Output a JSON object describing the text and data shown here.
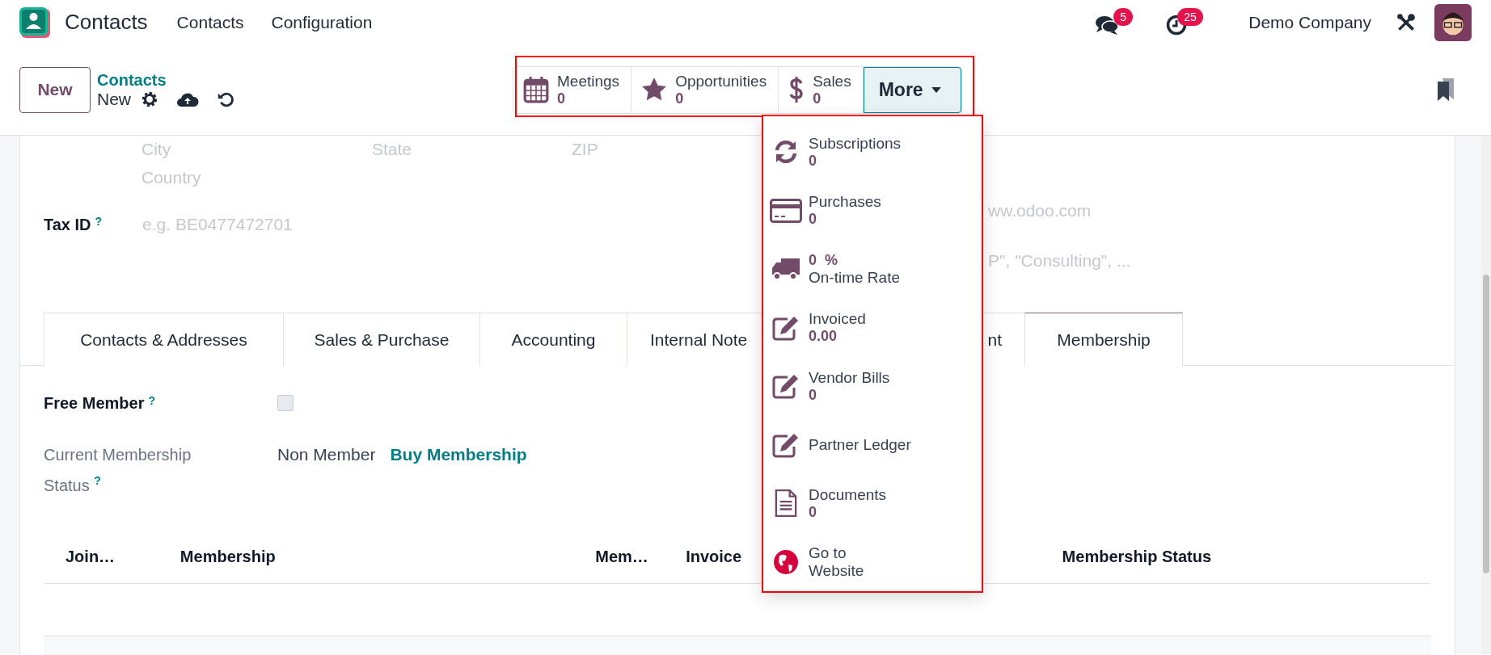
{
  "navbar": {
    "app_name": "Contacts",
    "menu": [
      "Contacts",
      "Configuration"
    ],
    "messages_badge": "5",
    "activities_badge": "25",
    "company": "Demo Company"
  },
  "control_panel": {
    "new_button": "New",
    "breadcrumb": "Contacts",
    "record": "New"
  },
  "smart_buttons": [
    {
      "label": "Meetings",
      "value": "0"
    },
    {
      "label": "Opportunities",
      "value": "0"
    },
    {
      "label": "Sales",
      "value": "0"
    }
  ],
  "more_button": {
    "label": "More",
    "expanded": true
  },
  "more_menu": [
    {
      "kind": "stat",
      "label": "Subscriptions",
      "value": "0"
    },
    {
      "kind": "stat",
      "label": "Purchases",
      "value": "0"
    },
    {
      "kind": "value_first",
      "label": "On-time Rate",
      "value": "0  %"
    },
    {
      "kind": "stat",
      "label": "Invoiced",
      "value": "0.00"
    },
    {
      "kind": "stat",
      "label": "Vendor Bills",
      "value": "0"
    },
    {
      "kind": "label",
      "label": "Partner Ledger"
    },
    {
      "kind": "stat",
      "label": "Documents",
      "value": "0"
    },
    {
      "kind": "label_wrap",
      "label": "Go to Website"
    }
  ],
  "form": {
    "address_placeholders": [
      "City",
      "State",
      "ZIP"
    ],
    "country_placeholder": "Country",
    "tax_id": {
      "label": "Tax ID",
      "help": "?",
      "placeholder": "e.g. BE0477472701"
    },
    "right_field_placeholders": [
      "ww.odoo.com",
      "P\", \"Consulting\", ..."
    ]
  },
  "tabs": [
    {
      "label": "Contacts & Addresses",
      "selected": false
    },
    {
      "label": "Sales & Purchase",
      "selected": false
    },
    {
      "label": "Accounting",
      "selected": false
    },
    {
      "label": "Internal Note",
      "selected": false
    },
    {
      "label": "nt",
      "selected": false
    },
    {
      "label": "Membership",
      "selected": true
    }
  ],
  "membership": {
    "free_member": {
      "label": "Free Member",
      "help": "?",
      "checked": false
    },
    "status": {
      "label": "Current Membership Status",
      "help": "?",
      "value": "Non Member",
      "action": "Buy Membership"
    }
  },
  "table": {
    "columns": [
      "Join…",
      "Membership",
      "Mem…",
      "Invoice",
      "Membership Status"
    ]
  }
}
